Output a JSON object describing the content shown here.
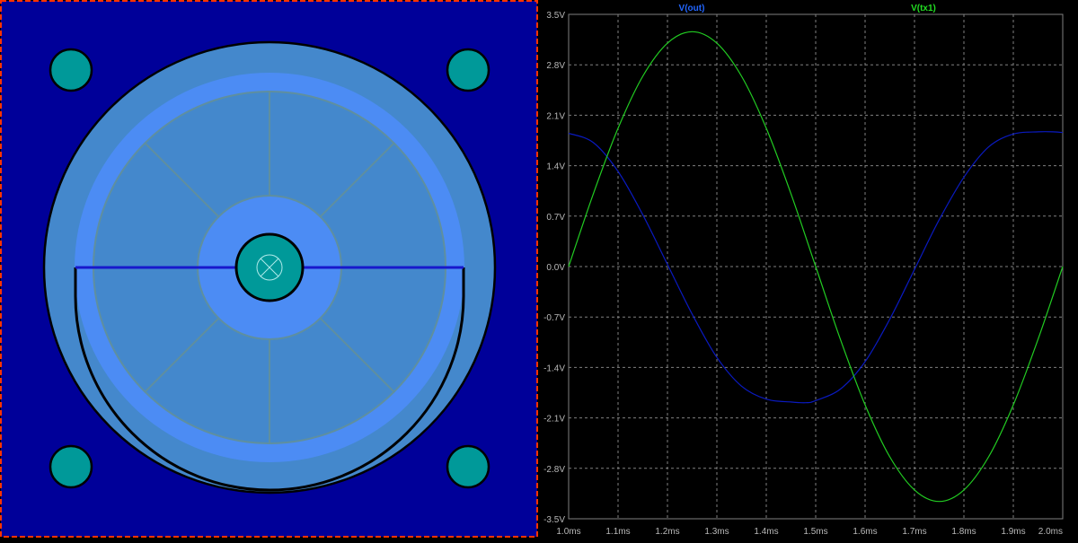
{
  "colors": {
    "board": "#000099",
    "board_frame": "#ff3300",
    "ring": "#4488cc",
    "groove": "#4c8cf4",
    "spoke": "#5f8f9f",
    "teal": "#009999",
    "outline": "#000000",
    "chord": "#1818cc",
    "plot_bg": "#000000",
    "grid": "#808080",
    "axis_text": "#b8b8b8",
    "series_out": "#0a1ac0",
    "series_tx1": "#22cc22",
    "legend_out": "#2266ff",
    "legend_tx1": "#22dd22"
  },
  "chart_data": {
    "type": "line",
    "x_ticks": [
      "1.0ms",
      "1.1ms",
      "1.2ms",
      "1.3ms",
      "1.4ms",
      "1.5ms",
      "1.6ms",
      "1.7ms",
      "1.8ms",
      "1.9ms",
      "2.0ms"
    ],
    "y_ticks": [
      "3.5V",
      "2.8V",
      "2.1V",
      "1.4V",
      "0.7V",
      "0.0V",
      "-0.7V",
      "-1.4V",
      "-2.1V",
      "-2.8V",
      "-3.5V"
    ],
    "xlim": [
      1.0,
      2.0
    ],
    "ylim": [
      -3.5,
      3.5
    ],
    "x_unit": "ms",
    "y_unit": "V",
    "grid": true,
    "series": [
      {
        "name": "V(out)",
        "x": [
          1.0,
          1.05,
          1.1,
          1.15,
          1.2,
          1.25,
          1.3,
          1.35,
          1.4,
          1.45,
          1.48,
          1.5,
          1.55,
          1.6,
          1.65,
          1.7,
          1.75,
          1.8,
          1.85,
          1.9,
          1.95,
          1.98,
          2.0
        ],
        "y": [
          1.85,
          1.72,
          1.32,
          0.72,
          0.03,
          -0.66,
          -1.26,
          -1.66,
          -1.84,
          -1.88,
          -1.89,
          -1.86,
          -1.7,
          -1.32,
          -0.73,
          -0.04,
          0.65,
          1.24,
          1.66,
          1.84,
          1.87,
          1.87,
          1.86
        ]
      },
      {
        "name": "V(tx1)",
        "x": [
          1.0,
          1.05,
          1.1,
          1.15,
          1.2,
          1.25,
          1.3,
          1.35,
          1.4,
          1.45,
          1.5,
          1.55,
          1.6,
          1.65,
          1.7,
          1.75,
          1.8,
          1.85,
          1.9,
          1.95,
          2.0
        ],
        "y": [
          0.0,
          1.01,
          1.92,
          2.64,
          3.1,
          3.26,
          3.1,
          2.64,
          1.92,
          1.01,
          0.0,
          -1.01,
          -1.92,
          -2.64,
          -3.1,
          -3.26,
          -3.1,
          -2.64,
          -1.92,
          -1.01,
          0.0
        ]
      }
    ]
  }
}
